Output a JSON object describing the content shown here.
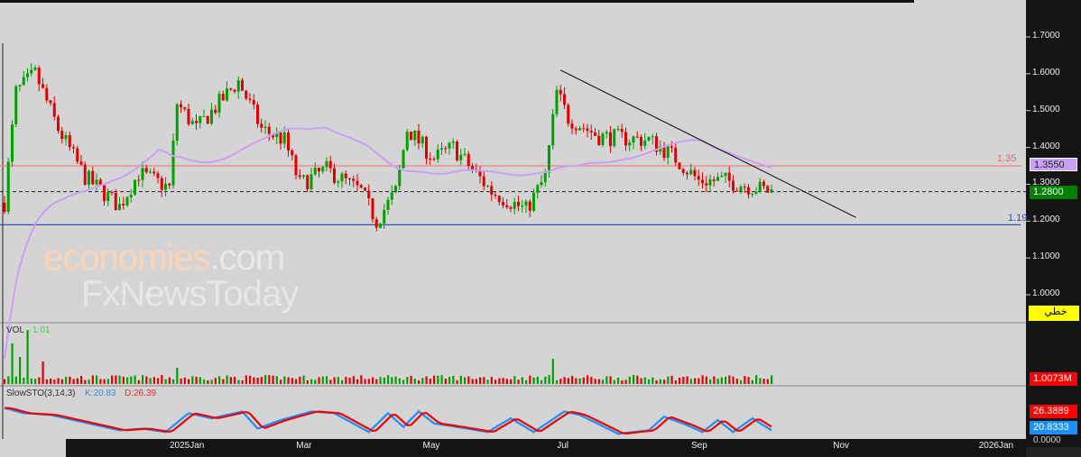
{
  "price_axis": {
    "ticks": [
      "1.7000",
      "1.6000",
      "1.5000",
      "1.4000",
      "1.3000",
      "1.2000",
      "1.1000",
      "1.0000"
    ],
    "values": [
      1.7,
      1.6,
      1.5,
      1.4,
      1.3,
      1.2,
      1.1,
      1.0
    ]
  },
  "tags": {
    "ma": "1.3550",
    "last": "1.2800",
    "mode": "خطي",
    "vol": "1.0073M",
    "d": "26.3889",
    "k": "20.8333",
    "sto_zero": "0.0000"
  },
  "levels": {
    "resistance": {
      "label": "1.35",
      "value": 1.35,
      "color": "#f08080"
    },
    "support": {
      "label": "1.19",
      "value": 1.19,
      "color": "#3050c0"
    },
    "last": 1.28
  },
  "trendline": {
    "from": [
      145,
      1.61
    ],
    "to": [
      222,
      1.21
    ]
  },
  "time_axis": [
    {
      "label": "2025Jan",
      "bar": 44
    },
    {
      "label": "Mar",
      "bar": 77
    },
    {
      "label": "May",
      "bar": 110
    },
    {
      "label": "Jul",
      "bar": 145
    },
    {
      "label": "Sep",
      "bar": 180
    },
    {
      "label": "Nov",
      "bar": 217
    },
    {
      "label": "2026Jan",
      "bar": 255
    }
  ],
  "price_path": [
    [
      0,
      1.25
    ],
    [
      3,
      1.55
    ],
    [
      8,
      1.6
    ],
    [
      14,
      1.45
    ],
    [
      21,
      1.32
    ],
    [
      30,
      1.24
    ],
    [
      35,
      1.33
    ],
    [
      43,
      1.29
    ],
    [
      45,
      1.52
    ],
    [
      50,
      1.45
    ],
    [
      61,
      1.58
    ],
    [
      67,
      1.45
    ],
    [
      73,
      1.42
    ],
    [
      77,
      1.3
    ],
    [
      84,
      1.34
    ],
    [
      93,
      1.28
    ],
    [
      97,
      1.2
    ],
    [
      102,
      1.28
    ],
    [
      105,
      1.45
    ],
    [
      112,
      1.37
    ],
    [
      117,
      1.4
    ],
    [
      127,
      1.28
    ],
    [
      136,
      1.23
    ],
    [
      141,
      1.32
    ],
    [
      144,
      1.55
    ],
    [
      147,
      1.48
    ],
    [
      155,
      1.43
    ],
    [
      168,
      1.42
    ],
    [
      174,
      1.38
    ],
    [
      181,
      1.31
    ],
    [
      188,
      1.31
    ],
    [
      200,
      1.28
    ]
  ],
  "ma_period": 40,
  "volume": {
    "label": "VOL",
    "value": "1.01",
    "spikes": [
      [
        2,
        45
      ],
      [
        4,
        30
      ],
      [
        6,
        60
      ],
      [
        10,
        25
      ],
      [
        45,
        18
      ],
      [
        143,
        28
      ]
    ]
  },
  "stochastic": {
    "label": "SlowSTO(3,14,3)",
    "k_label": "K:20.83",
    "d_label": "D:26.39",
    "path": [
      [
        0,
        85
      ],
      [
        5,
        70
      ],
      [
        12,
        65
      ],
      [
        20,
        45
      ],
      [
        30,
        20
      ],
      [
        36,
        25
      ],
      [
        42,
        15
      ],
      [
        48,
        70
      ],
      [
        54,
        55
      ],
      [
        62,
        75
      ],
      [
        66,
        25
      ],
      [
        72,
        50
      ],
      [
        80,
        75
      ],
      [
        86,
        70
      ],
      [
        95,
        15
      ],
      [
        100,
        70
      ],
      [
        104,
        30
      ],
      [
        108,
        75
      ],
      [
        112,
        40
      ],
      [
        118,
        30
      ],
      [
        126,
        15
      ],
      [
        132,
        55
      ],
      [
        138,
        15
      ],
      [
        146,
        75
      ],
      [
        150,
        65
      ],
      [
        160,
        10
      ],
      [
        168,
        20
      ],
      [
        172,
        60
      ],
      [
        178,
        35
      ],
      [
        182,
        15
      ],
      [
        186,
        50
      ],
      [
        190,
        15
      ],
      [
        195,
        55
      ],
      [
        200,
        20
      ]
    ]
  },
  "watermark": {
    "line1a": "economies",
    "line1b": ".com",
    "line2": "FxNewsToday"
  }
}
